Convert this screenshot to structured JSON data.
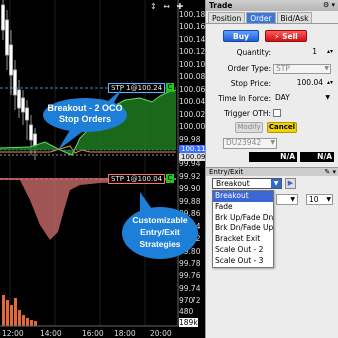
{
  "chart": {
    "y_labels": [
      "100.18",
      "100.16",
      "100.14",
      "100.12",
      "100.10",
      "100.08",
      "100.06",
      "100.04",
      "100.02",
      "100.00",
      "99.98",
      "99.96",
      "99.94",
      "99.92",
      "99.90",
      "99.88",
      "99.86",
      "99.84",
      "99.82",
      "99.80",
      "99.78",
      "99.76",
      "99.74",
      "99.72"
    ],
    "last_price": "100.11",
    "bid_price": "100.09",
    "stp_upper": {
      "label": "STP 1@100.24",
      "tag": "C"
    },
    "stp_lower": {
      "label": "STP 1@100.04",
      "tag": "C"
    },
    "volume_labels": [
      "970",
      "480",
      "189k"
    ],
    "x_labels": [
      "12:00",
      "14:00",
      "16:00",
      "18:00",
      "20:00"
    ],
    "annotation_oco": [
      "Breakout - 2 OCO",
      "Stop Orders"
    ],
    "annotation_strategies": [
      "Customizable",
      "Entry/Exit",
      "Strategies"
    ],
    "top_icons": "↕ ↔ ✚",
    "colors": {
      "bubble": "#1e7fd8",
      "band_up": "#1f9a1f",
      "band_down": "#c05a5a",
      "stp_upper": "#5ab4ff",
      "stp_lower": "#ff7070",
      "volume": "#e06a3c"
    }
  },
  "panel": {
    "title": "Trade",
    "title_icons": "⚙ ▾",
    "tabs": [
      "Position",
      "Order",
      "Bid/Ask"
    ],
    "active_tab": 1,
    "buy_label": "Buy",
    "sell_label": "Sell",
    "quantity": {
      "label": "Quantity:",
      "value": "1"
    },
    "order_type": {
      "label": "Order Type:",
      "value": "STP"
    },
    "stop_price": {
      "label": "Stop Price:",
      "value": "100.04"
    },
    "tif": {
      "label": "Time In Force:",
      "value": "DAY"
    },
    "trigger": {
      "label": "Trigger OTH:"
    },
    "modify_label": "Modify",
    "cancel_label": "Cancel",
    "order_id": "DU23942",
    "na_left": "N/A",
    "na_right": "N/A",
    "section_title": "Entry/Exit",
    "section_icons": "✎ ▾",
    "selected_strategy": "Breakout",
    "strategy_options": [
      "Breakout",
      "Fade",
      "Brk Up/Fade Dn",
      "Brk Dn/Fade Up",
      "Bracket Exit",
      "Scale Out - 2",
      "Scale Out - 3"
    ],
    "strategy_qty": "10"
  }
}
